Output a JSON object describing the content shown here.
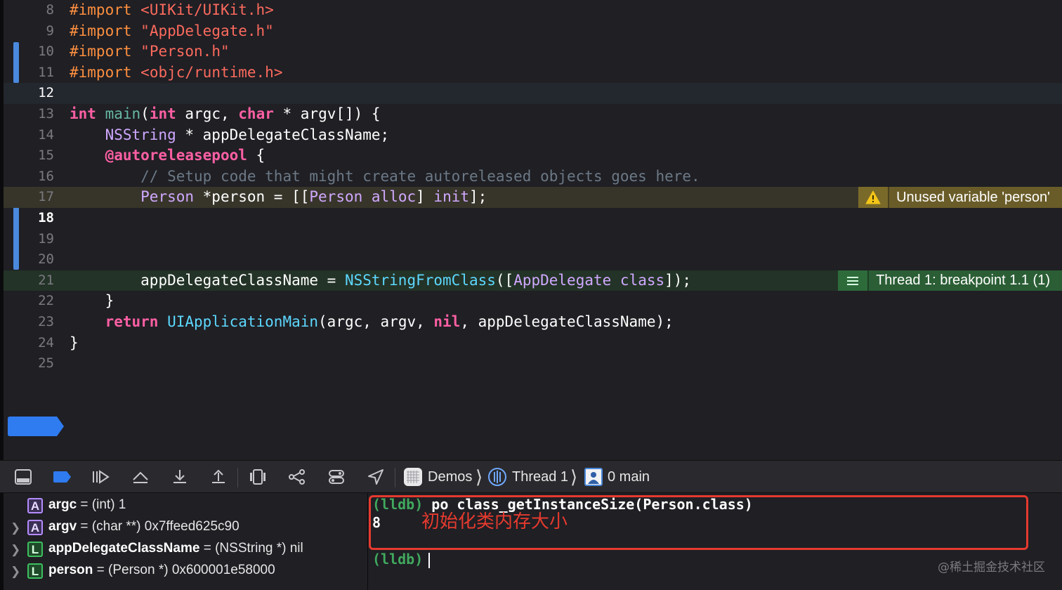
{
  "editor": {
    "lines": [
      {
        "n": "8"
      },
      {
        "n": "9"
      },
      {
        "n": "10"
      },
      {
        "n": "11"
      },
      {
        "n": "12"
      },
      {
        "n": "13"
      },
      {
        "n": "14"
      },
      {
        "n": "15"
      },
      {
        "n": "16"
      },
      {
        "n": "17"
      },
      {
        "n": "18"
      },
      {
        "n": "19"
      },
      {
        "n": "20"
      },
      {
        "n": "21"
      },
      {
        "n": "22"
      },
      {
        "n": "23"
      },
      {
        "n": "24"
      },
      {
        "n": "25"
      }
    ],
    "code": {
      "l8_kw": "#import",
      "l8_str": "<UIKit/UIKit.h>",
      "l9_kw": "#import",
      "l9_str": "\"AppDelegate.h\"",
      "l10_kw": "#import",
      "l10_str": "\"Person.h\"",
      "l11_kw": "#import",
      "l11_str": "<objc/runtime.h>",
      "l13_int": "int",
      "l13_main": "main",
      "l13_int2": "int",
      "l13_argc": " argc, ",
      "l13_char": "char",
      "l13_rest": " * argv[]) {",
      "l14_type": "NSString",
      "l14_rest": " * appDelegateClassName;",
      "l15_kw": "@autoreleasepool",
      "l15_rest": " {",
      "l16_comment": "// Setup code that might create autoreleased objects goes here.",
      "l17_type": "Person",
      "l17_a": " *person = [[",
      "l17_cls": "Person",
      "l17_sp": " ",
      "l17_alloc": "alloc",
      "l17_b": "] ",
      "l17_init": "init",
      "l17_c": "];",
      "l21_a": "appDelegateClassName = ",
      "l21_fn": "NSStringFromClass",
      "l21_b": "([",
      "l21_cls": "AppDelegate",
      "l21_sp": " ",
      "l21_class": "class",
      "l21_c": "]);",
      "l22": "}",
      "l23_ret": "return",
      "l23_fn": "UIApplicationMain",
      "l23_a": "(argc, argv, ",
      "l23_nil": "nil",
      "l23_b": ", appDelegateClassName);",
      "l24": "}"
    },
    "annotations": {
      "warning": "Unused variable 'person'",
      "breakpoint": "Thread 1: breakpoint 1.1 (1)"
    }
  },
  "debug_bar": {
    "breadcrumb": [
      "Demos",
      "Thread 1",
      "0 main"
    ]
  },
  "variables": [
    {
      "kind": "A",
      "name": "argc",
      "eq": " = ",
      "type": "(int)",
      "value": " 1"
    },
    {
      "kind": "A",
      "name": "argv",
      "eq": " = ",
      "type": "(char **)",
      "value": " 0x7ffeed625c90"
    },
    {
      "kind": "L",
      "name": "appDelegateClassName",
      "eq": " = ",
      "type": "(NSString *)",
      "value": " nil"
    },
    {
      "kind": "L",
      "name": "person",
      "eq": " = ",
      "type": "(Person *)",
      "value": " 0x600001e58000"
    }
  ],
  "console": {
    "prompt": "(lldb)",
    "command": " po class_getInstanceSize(Person.class)",
    "output": "8",
    "annotation": "初始化类内存大小",
    "prompt2": "(lldb)"
  },
  "watermark": "@稀土掘金技术社区",
  "colors": {
    "keyword": "#fc5fa3",
    "string": "#fc6a5d",
    "preprocessor": "#fd8f3f",
    "function": "#67b7a4",
    "type": "#d0a8ff",
    "comment": "#6c7986",
    "breakpoint": "#4a89dc",
    "highlight_box": "#e53a2e"
  }
}
